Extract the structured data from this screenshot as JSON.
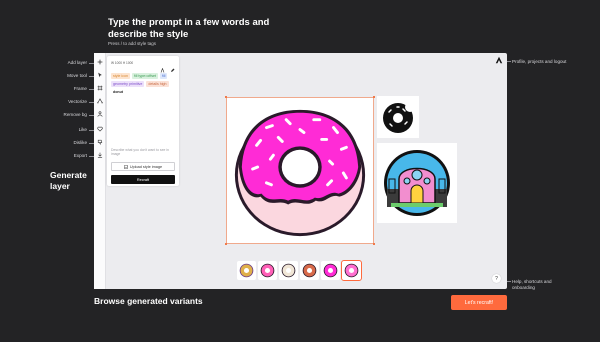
{
  "intro": {
    "heading": "Type the prompt in a few words and describe the style",
    "subheading": "Press / to add style tags"
  },
  "left_labels": [
    "Add layer",
    "Move tool",
    "Frame",
    "Vectorize",
    "Remove bg",
    "Like",
    "Dislike",
    "Export"
  ],
  "generate_label": "Generate layer",
  "browse_label": "Browse generated variants",
  "right_labels": {
    "top": "Profile, projects and logout",
    "bottom": "Help, shortcuts and onboarding"
  },
  "panel": {
    "header": "W 1000 H 1000",
    "tags": [
      {
        "text": "style icon",
        "color": "orange"
      },
      {
        "text": "fill type=offset",
        "color": "green"
      },
      {
        "text": "fill",
        "color": "blue"
      },
      {
        "text": "geometry primitive",
        "color": "purple"
      },
      {
        "text": "details high",
        "color": "peach"
      },
      {
        "text": "donut",
        "color": "plain"
      }
    ],
    "hint": "Describe what you don't want to see in image",
    "upload_label": "Upload style image",
    "recraft_label": "Recraft"
  },
  "cta_label": "Let's recraft!",
  "help_label": "?",
  "colors": {
    "accent": "#ff6a3d",
    "donut_pink": "#ff2bd6",
    "donut_dough": "#fbd7df",
    "outline": "#2a1a2a"
  },
  "icons": {
    "toolbar": [
      "plus-icon",
      "cursor-icon",
      "frame-icon",
      "vectorize-icon",
      "remove-bg-icon",
      "heart-icon",
      "thumbs-down-icon",
      "download-icon"
    ]
  }
}
